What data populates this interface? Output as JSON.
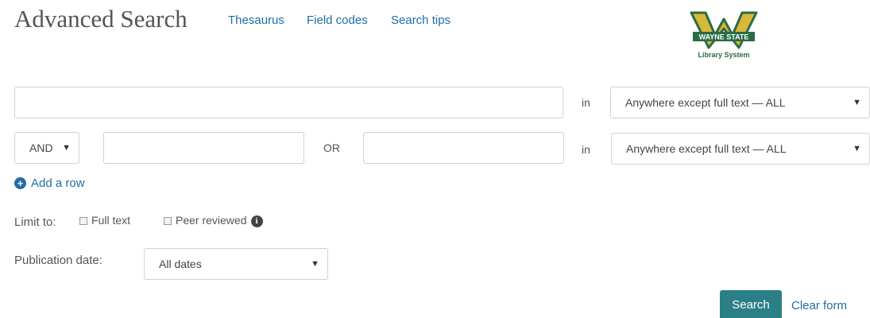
{
  "header": {
    "title": "Advanced Search",
    "links": [
      "Thesaurus",
      "Field codes",
      "Search tips"
    ]
  },
  "logo": {
    "name": "WAYNE STATE",
    "subtitle": "Library System",
    "colors": {
      "green": "#2a6c44",
      "gold": "#d8b83a"
    }
  },
  "rows": [
    {
      "value": "",
      "in_label": "in",
      "field_select": "Anywhere except full text — ALL"
    },
    {
      "operator": "AND",
      "value": "",
      "or_label": "OR",
      "value2": "",
      "in_label": "in",
      "field_select": "Anywhere except full text — ALL"
    }
  ],
  "add_row": "Add a row",
  "limit": {
    "label": "Limit to:",
    "options": [
      "Full text",
      "Peer reviewed"
    ]
  },
  "publication_date": {
    "label": "Publication date:",
    "value": "All dates"
  },
  "actions": {
    "search": "Search",
    "clear": "Clear form"
  },
  "colors": {
    "link": "#1f6ea6",
    "search_button": "#2b7f86"
  }
}
